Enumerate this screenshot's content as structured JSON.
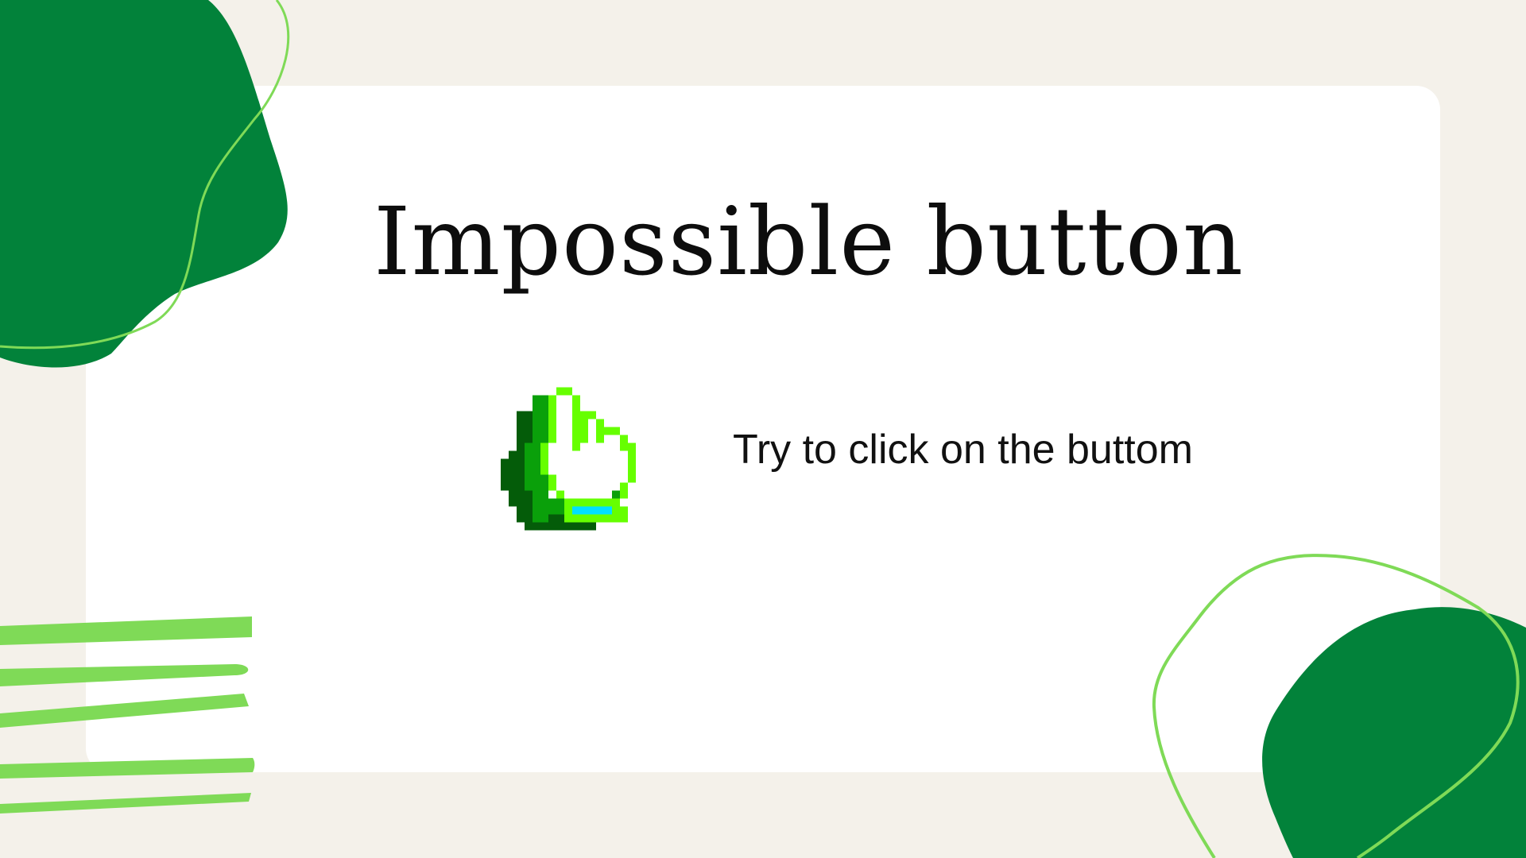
{
  "heading": {
    "title": "Impossible button"
  },
  "instruction": {
    "text": "Try to click on the buttom"
  },
  "cursor": {
    "icon": "pixel-hand-pointer-icon"
  },
  "colors": {
    "background": "#f4f1ea",
    "card": "#ffffff",
    "dark_green": "#02823a",
    "light_green": "#7fda57",
    "cursor_outline": "#66ff00",
    "cursor_shadow_dark": "#045c09",
    "cursor_shadow_mid": "#0aa00a",
    "cursor_cuff": "#00e0ff"
  }
}
